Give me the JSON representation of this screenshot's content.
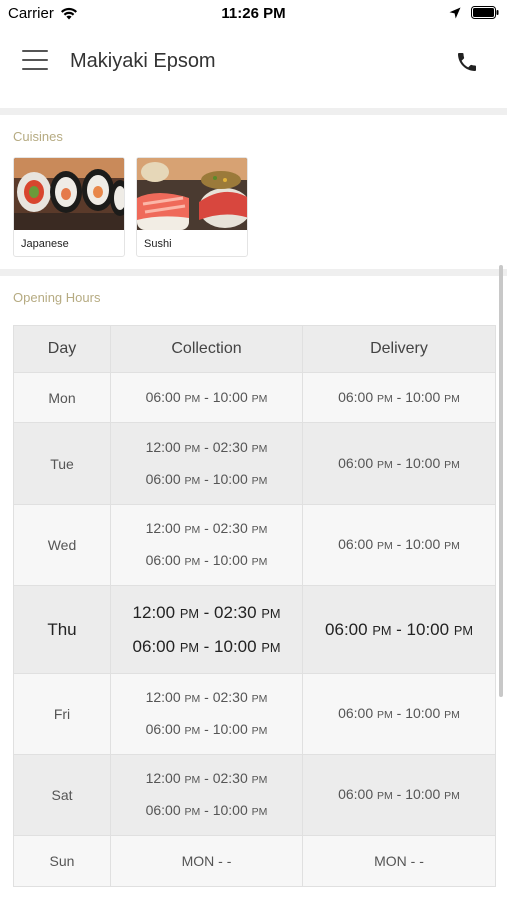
{
  "status_bar": {
    "carrier": "Carrier",
    "time": "11:26 PM"
  },
  "header": {
    "title": "Makiyaki Epsom"
  },
  "cuisines": {
    "label": "Cuisines",
    "items": [
      {
        "name": "Japanese"
      },
      {
        "name": "Sushi"
      }
    ]
  },
  "opening_hours": {
    "label": "Opening Hours",
    "columns": [
      "Day",
      "Collection",
      "Delivery"
    ],
    "rows": [
      {
        "day": "Mon",
        "collection": [
          [
            "06:00",
            "PM",
            "10:00",
            "PM"
          ]
        ],
        "delivery": [
          [
            "06:00",
            "PM",
            "10:00",
            "PM"
          ]
        ]
      },
      {
        "day": "Tue",
        "collection": [
          [
            "12:00",
            "PM",
            "02:30",
            "PM"
          ],
          [
            "06:00",
            "PM",
            "10:00",
            "PM"
          ]
        ],
        "delivery": [
          [
            "06:00",
            "PM",
            "10:00",
            "PM"
          ]
        ]
      },
      {
        "day": "Wed",
        "collection": [
          [
            "12:00",
            "PM",
            "02:30",
            "PM"
          ],
          [
            "06:00",
            "PM",
            "10:00",
            "PM"
          ]
        ],
        "delivery": [
          [
            "06:00",
            "PM",
            "10:00",
            "PM"
          ]
        ]
      },
      {
        "day": "Thu",
        "collection": [
          [
            "12:00",
            "PM",
            "02:30",
            "PM"
          ],
          [
            "06:00",
            "PM",
            "10:00",
            "PM"
          ]
        ],
        "delivery": [
          [
            "06:00",
            "PM",
            "10:00",
            "PM"
          ]
        ],
        "highlight": true
      },
      {
        "day": "Fri",
        "collection": [
          [
            "12:00",
            "PM",
            "02:30",
            "PM"
          ],
          [
            "06:00",
            "PM",
            "10:00",
            "PM"
          ]
        ],
        "delivery": [
          [
            "06:00",
            "PM",
            "10:00",
            "PM"
          ]
        ]
      },
      {
        "day": "Sat",
        "collection": [
          [
            "12:00",
            "PM",
            "02:30",
            "PM"
          ],
          [
            "06:00",
            "PM",
            "10:00",
            "PM"
          ]
        ],
        "delivery": [
          [
            "06:00",
            "PM",
            "10:00",
            "PM"
          ]
        ]
      },
      {
        "day": "Sun",
        "collection_text": "MON - -",
        "delivery_text": "MON - -"
      }
    ]
  },
  "colors": {
    "section_label": "#b6ab82",
    "divider": "#efefef",
    "row_light": "#f7f7f7",
    "row_dark": "#ececec"
  }
}
